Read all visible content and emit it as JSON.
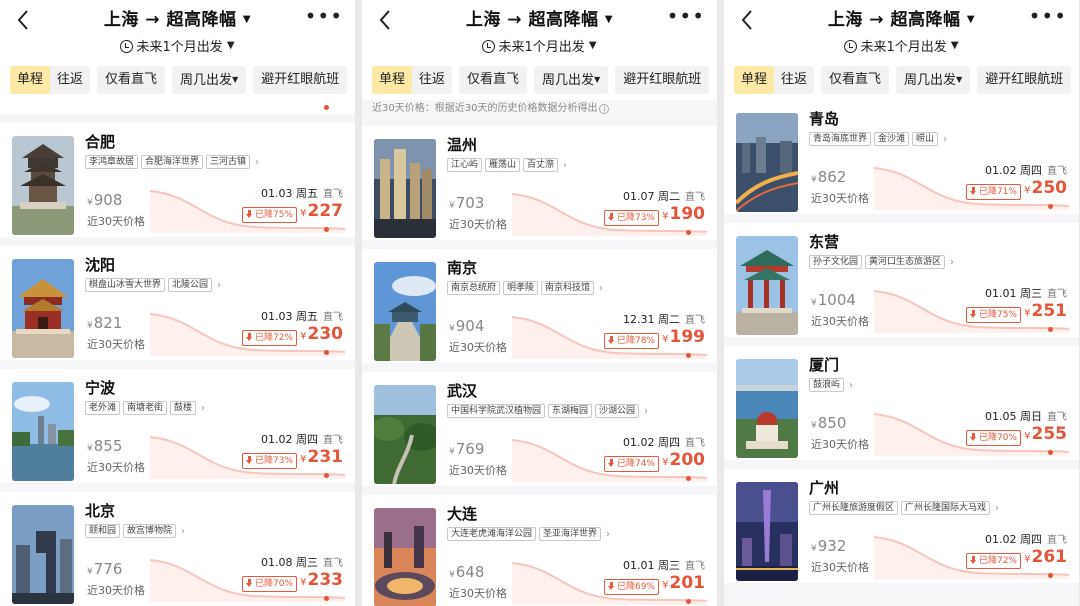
{
  "header": {
    "title": "上海 → 超高降幅",
    "date_range": "未来1个月出发"
  },
  "filters": {
    "one_way": "单程",
    "round_trip": "往返",
    "direct_only": "仅看直飞",
    "weekday": "周几出发",
    "avoid_redeye": "避开红眼航班"
  },
  "common": {
    "hist_label": "近30天价格",
    "currency": "¥",
    "direct": "直飞",
    "note": "近30天价格：根据近30天的历史价格数据分析得出",
    "note_icon": "info-icon",
    "back_icon": "chevron-left-icon",
    "more_icon": "more-icon",
    "accent": "#e5553a",
    "selected_bg": "#fde9a6"
  },
  "panels": [
    {
      "cards": [
        {
          "city": "合肥",
          "tags": [
            "李鸿章故居",
            "合肥海洋世界",
            "三河古镇"
          ],
          "hist_price": "908",
          "date": "01.03 周五",
          "drop": "已降75%",
          "price": "227",
          "image": "pagoda-tower"
        },
        {
          "city": "沈阳",
          "tags": [
            "棋盘山冰雪大世界",
            "北陵公园"
          ],
          "hist_price": "821",
          "date": "01.03 周五",
          "drop": "已降72%",
          "price": "230",
          "image": "palace-gate"
        },
        {
          "city": "宁波",
          "tags": [
            "老外滩",
            "南塘老街",
            "鼓楼"
          ],
          "hist_price": "855",
          "date": "01.02 周四",
          "drop": "已降73%",
          "price": "231",
          "image": "lake-skyline"
        },
        {
          "city": "北京",
          "tags": [
            "颐和园",
            "故宫博物院"
          ],
          "hist_price": "776",
          "date": "01.08 周三",
          "drop": "已降70%",
          "price": "233",
          "image": "cctv-tower"
        }
      ]
    },
    {
      "cards": [
        {
          "city": "温州",
          "tags": [
            "江心屿",
            "雁荡山",
            "百丈漈"
          ],
          "hist_price": "703",
          "date": "01.07 周二",
          "drop": "已降73%",
          "price": "190",
          "image": "city-night"
        },
        {
          "city": "南京",
          "tags": [
            "南京总统府",
            "明孝陵",
            "南京科技馆"
          ],
          "hist_price": "904",
          "date": "12.31 周二",
          "drop": "已降78%",
          "price": "199",
          "image": "mausoleum-sky"
        },
        {
          "city": "武汉",
          "tags": [
            "中国科学院武汉植物园",
            "东湖梅园",
            "沙湖公园"
          ],
          "hist_price": "769",
          "date": "01.02 周四",
          "drop": "已降74%",
          "price": "200",
          "image": "green-road"
        },
        {
          "city": "大连",
          "tags": [
            "大连老虎滩海洋公园",
            "圣亚海洋世界"
          ],
          "hist_price": "648",
          "date": "01.01 周三",
          "drop": "已降69%",
          "price": "201",
          "image": "plaza-dusk"
        }
      ]
    },
    {
      "cards": [
        {
          "city": "青岛",
          "tags": [
            "青岛海底世界",
            "金沙滩",
            "崂山"
          ],
          "hist_price": "862",
          "date": "01.02 周四",
          "drop": "已降71%",
          "price": "250",
          "image": "bridge-night"
        },
        {
          "city": "东营",
          "tags": [
            "孙子文化园",
            "黄河口生态旅游区"
          ],
          "hist_price": "1004",
          "date": "01.01 周三",
          "drop": "已降75%",
          "price": "251",
          "image": "pavilion"
        },
        {
          "city": "厦门",
          "tags": [
            "鼓浪屿"
          ],
          "hist_price": "850",
          "date": "01.05 周日",
          "drop": "已降70%",
          "price": "255",
          "image": "harbor-dome"
        },
        {
          "city": "广州",
          "tags": [
            "广州长隆旅游度假区",
            "广州长隆国际大马戏"
          ],
          "hist_price": "932",
          "date": "01.02 周四",
          "drop": "已降72%",
          "price": "261",
          "image": "canton-tower"
        }
      ]
    }
  ]
}
